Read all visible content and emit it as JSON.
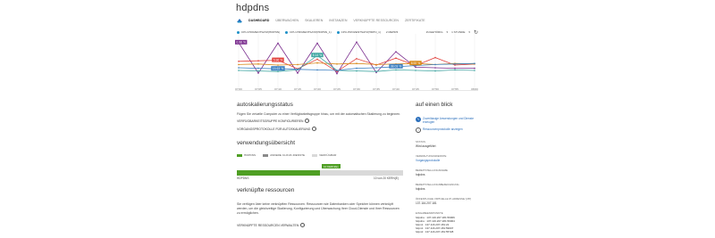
{
  "app": {
    "title": "hdpdns"
  },
  "tabs": [
    {
      "label": "DASHBOARD",
      "active": true
    },
    {
      "label": "ÜBERWACHEN",
      "active": false
    },
    {
      "label": "SKALIEREN",
      "active": false
    },
    {
      "label": "INSTANZEN",
      "active": false
    },
    {
      "label": "VERKNÜPFTE RESSOURCEN",
      "active": false
    },
    {
      "label": "ZERTIFIKATE",
      "active": false
    }
  ],
  "metrics_bar": {
    "items": [
      "CPU-PROZENTSATZ(HDPNN)",
      "CPU-PROZENTSATZ(HDPNN_1)",
      "CPU-PROZENTSATZ(HDPN_1)"
    ],
    "more_label": "2 MEHR",
    "mode_label": "ZUGEHÖRIG",
    "range_label": "1 STUNDE"
  },
  "chart_data": {
    "type": "line",
    "x": [
      "07:00",
      "07:05",
      "07:10",
      "07:15",
      "07:20",
      "07:25",
      "07:30",
      "07:35",
      "07:40",
      "07:45",
      "07:50",
      "07:55",
      "08:00"
    ],
    "series": [
      {
        "name": "",
        "color": "#7a2d8e",
        "values": [
          87,
          30,
          86,
          30,
          86,
          29,
          88,
          31,
          70,
          41,
          40,
          39,
          39
        ]
      },
      {
        "name": "",
        "color": "#e2423d",
        "values": [
          52,
          53,
          54,
          38,
          56,
          33,
          57,
          45,
          58,
          44,
          59,
          45,
          47
        ]
      },
      {
        "name": "",
        "color": "#d98a1a",
        "values": [
          46,
          47,
          45,
          46,
          49,
          47,
          48,
          46,
          47,
          48,
          46,
          48,
          47
        ]
      },
      {
        "name": "",
        "color": "#3fa6a1",
        "values": [
          35,
          34,
          33,
          36,
          63,
          35,
          34,
          33,
          36,
          35,
          34,
          36,
          35
        ]
      },
      {
        "name": "",
        "color": "#3a7fc1",
        "values": [
          40,
          39,
          38,
          37,
          36,
          35,
          39,
          40,
          42,
          44,
          46,
          47,
          48
        ]
      }
    ],
    "callouts": [
      {
        "text": "0.98 %",
        "series": 0,
        "index": 0
      },
      {
        "text": "5.96 %",
        "series": 1,
        "index": 2
      },
      {
        "text": "15.63 %",
        "series": 4,
        "index": 2
      },
      {
        "text": "6.14 %",
        "series": 3,
        "index": 4
      },
      {
        "text": "38.03 %",
        "series": 4,
        "index": 8
      },
      {
        "text": "8.92 %",
        "series": 2,
        "index": 9
      }
    ],
    "ylim": [
      0,
      100
    ],
    "grid": true
  },
  "autoscale": {
    "title": "autoskalierungsstatus",
    "text": "Fügen Sie virtuelle Computer zu einer Verfügbarkeitsgruppe hinzu, um mit der automatischen Skalierung zu beginnen.",
    "link1": "VERFÜGBARKEITSGRUPPE KONFIGURIEREN",
    "link2": "VORGANGSPROTOKOLLE FÜR AUTOSKALIERUNG"
  },
  "usage": {
    "title": "verwendungsübersicht",
    "legend": [
      "HDPDNS",
      "ANDERE CLOUD-DIENSTE",
      "VERFÜGBAR"
    ],
    "badge": "10 KERN(E)",
    "bar_label": "HDPDNS",
    "count_text": "10 von 20 KERN(E)",
    "fill_fraction": 0.5
  },
  "linked": {
    "title": "verknüpfte ressourcen",
    "text": "Sie verfügen über keine verknüpften Ressourcen. Ressourcen wie Datenbanken oder Speicher können verknüpft werden, um die gleichzeitige Skalierung, Konfigurierung und Überwachung Ihrer Cloud-Dienste und Ihrer Ressourcen zu ermöglichen.",
    "button": "VERKNÜPFTE RESSOURCEN VERWALTEN"
  },
  "quick": {
    "title": "auf einen blick",
    "item1": "Zuverlässige Anwendungen und Dienste erzeugen",
    "item2": "Ressourcenprotokolle anzeigen"
  },
  "props": [
    {
      "label": "STATUS",
      "value": "Wird ausgeführt"
    },
    {
      "label": "VERWALTUNGSDIENSTE",
      "value": "Vorgangsprotokolle"
    },
    {
      "label": "BEREITSTELLUNGSNAME",
      "value": "hdpdns"
    },
    {
      "label": "BEREITSTELLUNGSBEZEICHNUNG",
      "value": "hdpdns"
    },
    {
      "label": "ÖFFENTLICHE VIRTUELLE IP-ADRESSE (VIP)",
      "value": "137.116.207.181"
    }
  ],
  "endpoints": {
    "label": "EINGABEENDPUNKTE",
    "lines": [
      "hdpdns : 137.116.207.181:59006",
      "hdpdns : 137.116.207.181:59004",
      "hdpn1 : 137.116.207.181:22",
      "hdpn1 : 137.116.207.181:59007",
      "hdpn2 : 137.116.207.181:55728"
    ]
  }
}
